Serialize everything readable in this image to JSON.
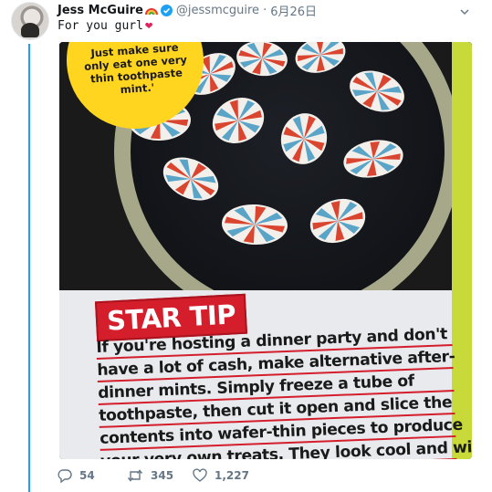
{
  "tweet": {
    "author_name": "Jess McGuire",
    "handle": "@jessmcguire",
    "separator": "·",
    "date": "6月26日",
    "text": "For you gurl",
    "emojis": [
      "rainbow",
      "red-heart"
    ]
  },
  "media": {
    "bubble_lines": [
      "Just make sure",
      "only eat one very",
      "thin toothpaste",
      "mint.'"
    ],
    "heading": "STAR TIP",
    "body_lines": [
      "If you're hosting a dinner party and don't",
      "have a lot of cash, make alternative after-",
      "dinner mints. Simply freeze a tube of",
      "toothpaste, then cut it open and slice the",
      "contents into wafer-thin pieces to produce",
      "your very own treats. They look cool and will"
    ]
  },
  "actions": {
    "replies": "54",
    "retweets": "345",
    "likes": "1,227"
  },
  "colors": {
    "accent": "#1da1f2",
    "muted": "#657786",
    "like": "#e0245e",
    "mag_red": "#d51e2c",
    "mag_yellow": "#ffd51f",
    "mag_green": "#c8da3a"
  },
  "icons": [
    "verified-badge-icon",
    "caret-down-icon",
    "reply-icon",
    "retweet-icon",
    "like-icon"
  ]
}
